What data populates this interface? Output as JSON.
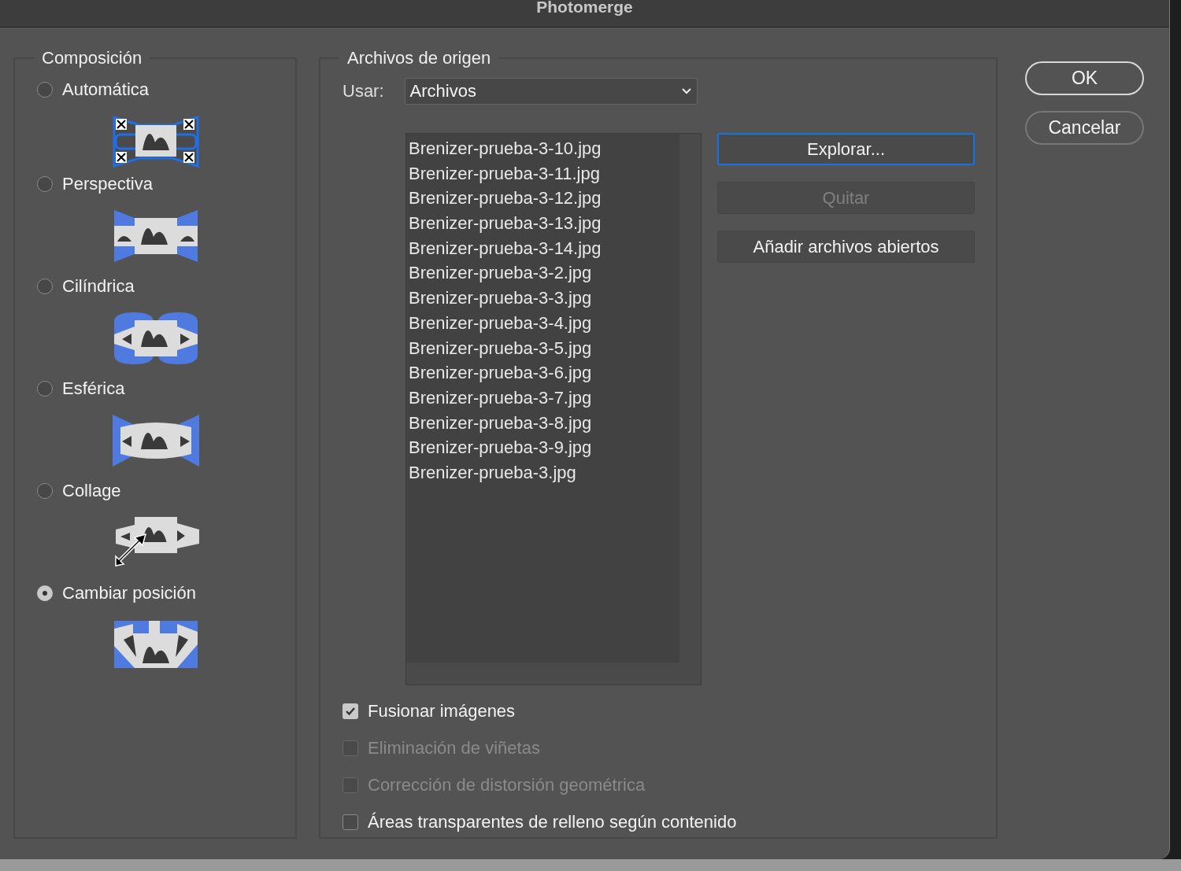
{
  "window": {
    "title": "Photomerge"
  },
  "composition": {
    "title": "Composición",
    "options": [
      {
        "label": "Automática",
        "kind": "auto",
        "selected": false
      },
      {
        "label": "Perspectiva",
        "kind": "perspective",
        "selected": false
      },
      {
        "label": "Cilíndrica",
        "kind": "cylindrical",
        "selected": false
      },
      {
        "label": "Esférica",
        "kind": "spherical",
        "selected": false
      },
      {
        "label": "Collage",
        "kind": "collage",
        "selected": false
      },
      {
        "label": "Cambiar posición",
        "kind": "reposition",
        "selected": true
      }
    ]
  },
  "source": {
    "title": "Archivos de origen",
    "use_label": "Usar:",
    "use_value": "Archivos",
    "files": [
      "Brenizer-prueba-3-10.jpg",
      "Brenizer-prueba-3-11.jpg",
      "Brenizer-prueba-3-12.jpg",
      "Brenizer-prueba-3-13.jpg",
      "Brenizer-prueba-3-14.jpg",
      "Brenizer-prueba-3-2.jpg",
      "Brenizer-prueba-3-3.jpg",
      "Brenizer-prueba-3-4.jpg",
      "Brenizer-prueba-3-5.jpg",
      "Brenizer-prueba-3-6.jpg",
      "Brenizer-prueba-3-7.jpg",
      "Brenizer-prueba-3-8.jpg",
      "Brenizer-prueba-3-9.jpg",
      "Brenizer-prueba-3.jpg"
    ],
    "buttons": [
      {
        "label": "Explorar...",
        "focused": true,
        "disabled": false
      },
      {
        "label": "Quitar",
        "focused": false,
        "disabled": true
      },
      {
        "label": "Añadir archivos abiertos",
        "focused": false,
        "disabled": false
      }
    ],
    "options": [
      {
        "label": "Fusionar imágenes",
        "checked": true,
        "disabled": false
      },
      {
        "label": "Eliminación de viñetas",
        "checked": false,
        "disabled": true
      },
      {
        "label": "Corrección de distorsión geométrica",
        "checked": false,
        "disabled": true
      },
      {
        "label": "Áreas transparentes de relleno según contenido",
        "checked": false,
        "disabled": false
      }
    ]
  },
  "actions": [
    {
      "label": "OK",
      "default": true
    },
    {
      "label": "Cancelar",
      "default": false
    }
  ]
}
